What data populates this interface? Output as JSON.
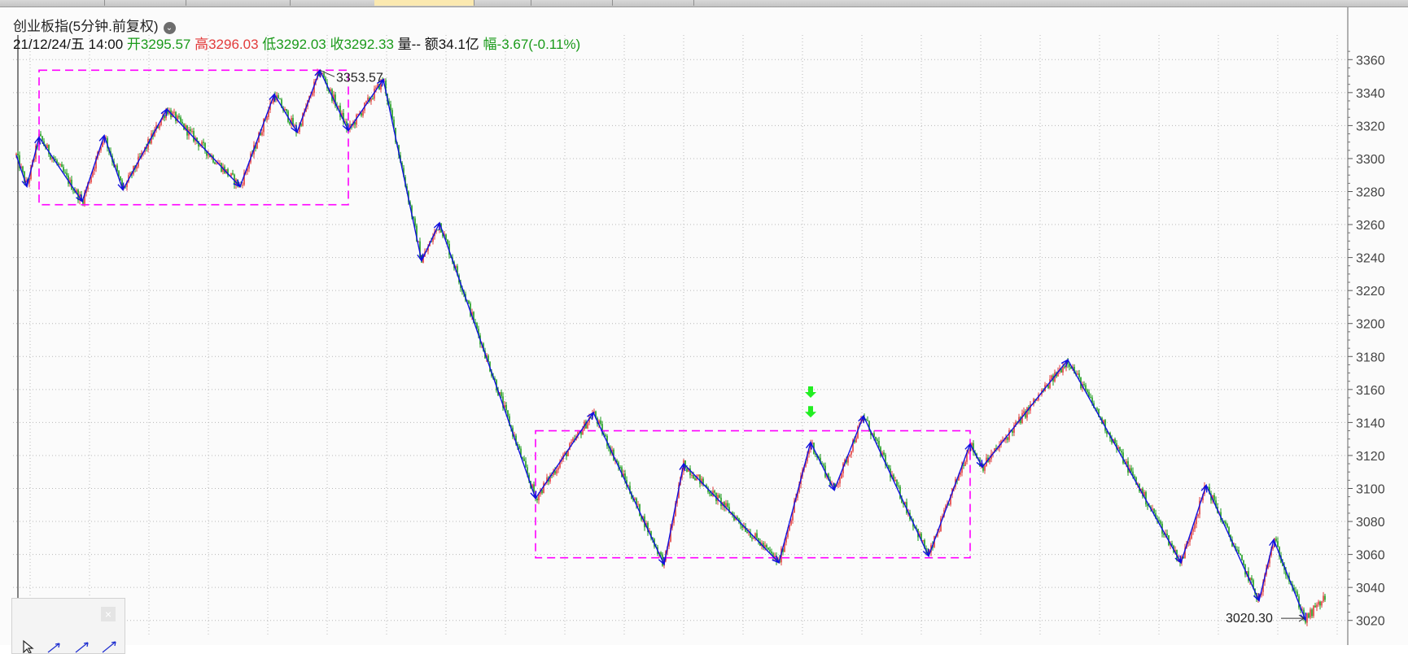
{
  "tabs": [
    "",
    "",
    "",
    "",
    "",
    "",
    "",
    ""
  ],
  "header": {
    "title": "创业板指(5分钟.前复权)",
    "datetime": "21/12/24/五 14:00",
    "open_label": "开",
    "open": "3295.57",
    "high_label": "高",
    "high": "3296.03",
    "low_label": "低",
    "low": "3292.03",
    "close_label": "收",
    "close": "3292.33",
    "volume_text": "量--",
    "amount_text": "额34.1亿",
    "change_label": "幅",
    "change": "-3.67(-0.11%)"
  },
  "annotations": {
    "high_point": "3353.57",
    "low_point": "3020.30"
  },
  "colors": {
    "up": "#e23b3b",
    "down": "#1a9a1a",
    "zigzag": "#1010e0",
    "box": "#ff00ff",
    "signal": "#22ee22",
    "grid": "#b8b8b8"
  },
  "chart_data": {
    "type": "candlestick",
    "title": "创业板指(5分钟.前复权)",
    "ylim": [
      3010,
      3370
    ],
    "yticks": [
      3020,
      3040,
      3060,
      3080,
      3100,
      3120,
      3140,
      3160,
      3180,
      3200,
      3220,
      3240,
      3260,
      3280,
      3300,
      3320,
      3340,
      3360
    ],
    "grid": true,
    "price_path": [
      {
        "x": 0,
        "y": 3302
      },
      {
        "x": 13,
        "y": 3283
      },
      {
        "x": 28,
        "y": 3313
      },
      {
        "x": 81,
        "y": 3274
      },
      {
        "x": 108,
        "y": 3314
      },
      {
        "x": 131,
        "y": 3281
      },
      {
        "x": 185,
        "y": 3330
      },
      {
        "x": 275,
        "y": 3283
      },
      {
        "x": 317,
        "y": 3339
      },
      {
        "x": 345,
        "y": 3316
      },
      {
        "x": 373,
        "y": 3353.57
      },
      {
        "x": 408,
        "y": 3317
      },
      {
        "x": 451,
        "y": 3348
      },
      {
        "x": 498,
        "y": 3238
      },
      {
        "x": 520,
        "y": 3261
      },
      {
        "x": 638,
        "y": 3094
      },
      {
        "x": 709,
        "y": 3146
      },
      {
        "x": 796,
        "y": 3054
      },
      {
        "x": 820,
        "y": 3115
      },
      {
        "x": 937,
        "y": 3055
      },
      {
        "x": 976,
        "y": 3128
      },
      {
        "x": 1005,
        "y": 3099
      },
      {
        "x": 1041,
        "y": 3144
      },
      {
        "x": 1121,
        "y": 3059
      },
      {
        "x": 1172,
        "y": 3127
      },
      {
        "x": 1187,
        "y": 3113
      },
      {
        "x": 1292,
        "y": 3178
      },
      {
        "x": 1431,
        "y": 3055
      },
      {
        "x": 1462,
        "y": 3102
      },
      {
        "x": 1527,
        "y": 3032
      },
      {
        "x": 1545,
        "y": 3069
      },
      {
        "x": 1584,
        "y": 3020.3
      },
      {
        "x": 1608,
        "y": 3034
      }
    ],
    "zigzag": [
      {
        "x": 0,
        "y": 3302
      },
      {
        "x": 13,
        "y": 3283
      },
      {
        "x": 28,
        "y": 3313
      },
      {
        "x": 81,
        "y": 3274
      },
      {
        "x": 108,
        "y": 3314
      },
      {
        "x": 131,
        "y": 3281
      },
      {
        "x": 185,
        "y": 3330
      },
      {
        "x": 275,
        "y": 3283
      },
      {
        "x": 317,
        "y": 3339
      },
      {
        "x": 345,
        "y": 3316
      },
      {
        "x": 373,
        "y": 3353.57
      },
      {
        "x": 408,
        "y": 3317
      },
      {
        "x": 451,
        "y": 3348
      },
      {
        "x": 498,
        "y": 3238
      },
      {
        "x": 520,
        "y": 3261
      },
      {
        "x": 638,
        "y": 3094
      },
      {
        "x": 709,
        "y": 3146
      },
      {
        "x": 796,
        "y": 3054
      },
      {
        "x": 820,
        "y": 3115
      },
      {
        "x": 937,
        "y": 3055
      },
      {
        "x": 976,
        "y": 3128
      },
      {
        "x": 1005,
        "y": 3099
      },
      {
        "x": 1041,
        "y": 3144
      },
      {
        "x": 1121,
        "y": 3059
      },
      {
        "x": 1172,
        "y": 3127
      },
      {
        "x": 1187,
        "y": 3113
      },
      {
        "x": 1292,
        "y": 3178
      },
      {
        "x": 1431,
        "y": 3055
      },
      {
        "x": 1462,
        "y": 3102
      },
      {
        "x": 1527,
        "y": 3032
      },
      {
        "x": 1545,
        "y": 3069
      },
      {
        "x": 1584,
        "y": 3020.3
      }
    ],
    "boxes": [
      {
        "x_from": 28,
        "x_to": 408,
        "y_low": 3272,
        "y_high": 3353.57
      },
      {
        "x_from": 638,
        "x_to": 1172,
        "y_low": 3058,
        "y_high": 3135
      }
    ],
    "signals": [
      {
        "x": 976,
        "y": 3143
      },
      {
        "x": 976,
        "y": 3155
      }
    ],
    "bars": 1610
  }
}
